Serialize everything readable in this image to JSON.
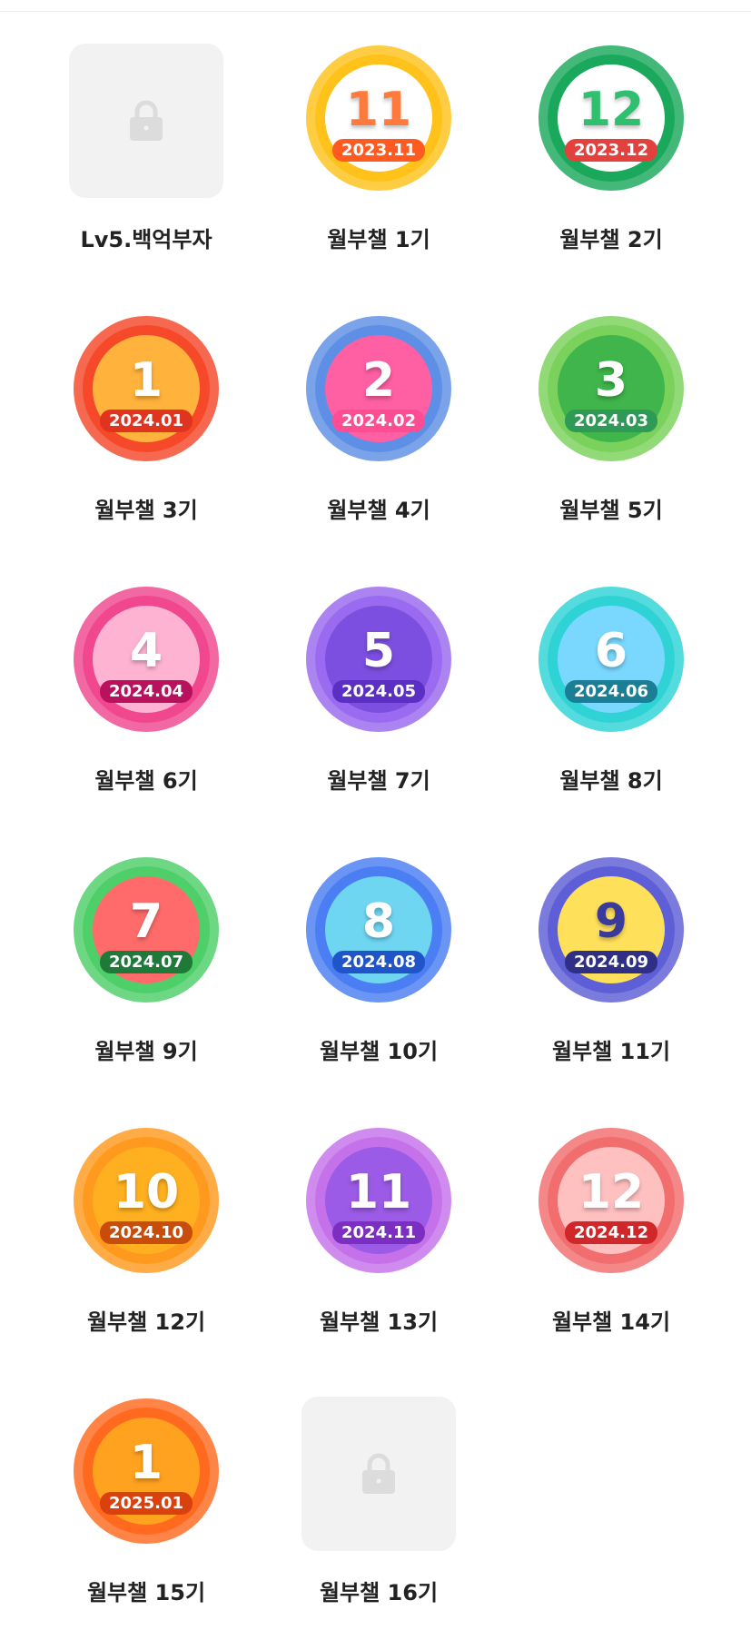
{
  "badges": [
    {
      "label": "Lv5.백억부자",
      "locked": true
    },
    {
      "label": "월부챌 1기",
      "locked": false,
      "number": "11",
      "date": "2023.11",
      "outer": "#ffc21a",
      "inner": "#ffffff",
      "num_color": "#ff7a3d",
      "pill": "#ff5a1f"
    },
    {
      "label": "월부챌 2기",
      "locked": false,
      "number": "12",
      "date": "2023.12",
      "outer": "#1aa95c",
      "inner": "#ffffff",
      "num_color": "#2fbf6e",
      "pill": "#e2413d"
    },
    {
      "label": "월부챌 3기",
      "locked": false,
      "number": "1",
      "date": "2024.01",
      "outer": "#f5492a",
      "inner": "#ffb23c",
      "num_color": "#ffffff",
      "pill": "#e0341f"
    },
    {
      "label": "월부챌 4기",
      "locked": false,
      "number": "2",
      "date": "2024.02",
      "outer": "#5d8fe6",
      "inner": "#ff5fa3",
      "num_color": "#ffffff",
      "pill": "#ff4d93"
    },
    {
      "label": "월부챌 5기",
      "locked": false,
      "number": "3",
      "date": "2024.03",
      "outer": "#7ad15b",
      "inner": "#3fb54b",
      "num_color": "#ffffff",
      "pill": "#2f9a55"
    },
    {
      "label": "월부챌 6기",
      "locked": false,
      "number": "4",
      "date": "2024.04",
      "outer": "#f0478f",
      "inner": "#ffb3d2",
      "num_color": "#ffffff",
      "pill": "#b8125e"
    },
    {
      "label": "월부챌 7기",
      "locked": false,
      "number": "5",
      "date": "2024.05",
      "outer": "#9a6af0",
      "inner": "#7c4fe0",
      "num_color": "#ffffff",
      "pill": "#5b2fc4"
    },
    {
      "label": "월부챌 8기",
      "locked": false,
      "number": "6",
      "date": "2024.06",
      "outer": "#2fd3d6",
      "inner": "#7ad8ff",
      "num_color": "#ffffff",
      "pill": "#1a7f94"
    },
    {
      "label": "월부챌 9기",
      "locked": false,
      "number": "7",
      "date": "2024.07",
      "outer": "#4fcf6a",
      "inner": "#ff6b6b",
      "num_color": "#ffffff",
      "pill": "#1f7a3a"
    },
    {
      "label": "월부챌 10기",
      "locked": false,
      "number": "8",
      "date": "2024.08",
      "outer": "#4a7ef2",
      "inner": "#6fd6f2",
      "num_color": "#ffffff",
      "pill": "#1f55c8"
    },
    {
      "label": "월부챌 11기",
      "locked": false,
      "number": "9",
      "date": "2024.09",
      "outer": "#5e5fd6",
      "inner": "#ffe05a",
      "num_color": "#3a3a9a",
      "pill": "#2f2f86"
    },
    {
      "label": "월부챌 12기",
      "locked": false,
      "number": "10",
      "date": "2024.10",
      "outer": "#ff9a1f",
      "inner": "#ffb020",
      "num_color": "#ffffff",
      "pill": "#c84c0a"
    },
    {
      "label": "월부챌 13기",
      "locked": false,
      "number": "11",
      "date": "2024.11",
      "outer": "#c572ea",
      "inner": "#9b5be6",
      "num_color": "#ffffff",
      "pill": "#7d2ec2"
    },
    {
      "label": "월부챌 14기",
      "locked": false,
      "number": "12",
      "date": "2024.12",
      "outer": "#f26d6d",
      "inner": "#ffc0c0",
      "num_color": "#ffffff",
      "pill": "#d0272a"
    },
    {
      "label": "월부챌 15기",
      "locked": false,
      "number": "1",
      "date": "2025.01",
      "outer": "#ff6a1f",
      "inner": "#ffa21f",
      "num_color": "#ffffff",
      "pill": "#d9420f"
    },
    {
      "label": "월부챌 16기",
      "locked": true
    }
  ]
}
